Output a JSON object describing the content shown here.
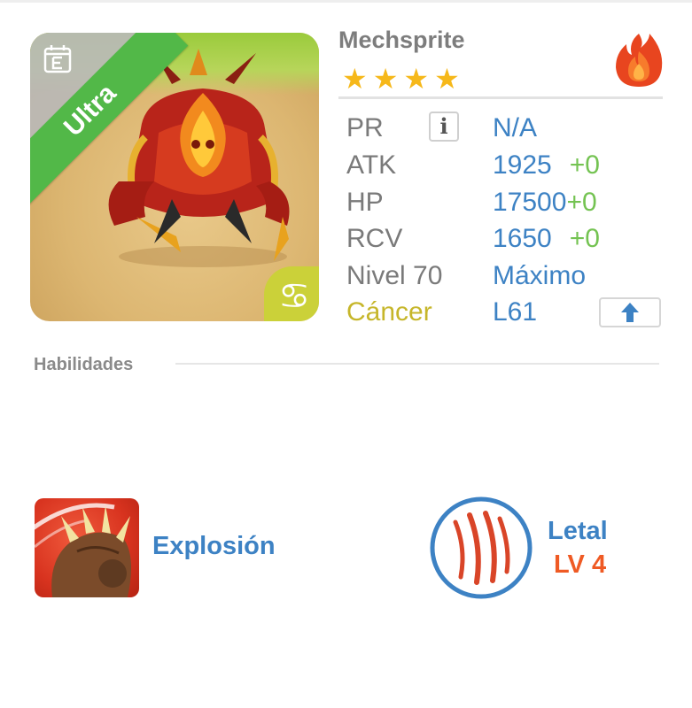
{
  "monster": {
    "name": "Mechsprite",
    "rank_label": "Ultra",
    "stars": [
      "★",
      "★",
      "★",
      "★"
    ],
    "element": "fire",
    "zodiac_glyph": "♋",
    "colors": {
      "ribbon": "#52b848",
      "star": "#f6b81a",
      "value": "#3d82c4",
      "bonus": "#74c352",
      "zodiac": "#c6b62a"
    }
  },
  "stats": {
    "pr": {
      "label": "PR",
      "value": "N/A",
      "info_glyph": "i"
    },
    "atk": {
      "label": "ATK",
      "value": "1925",
      "bonus": "+0"
    },
    "hp": {
      "label": "HP",
      "value": "17500",
      "bonus": "+0"
    },
    "rcv": {
      "label": "RCV",
      "value": "1650",
      "bonus": "+0"
    },
    "level": {
      "label": "Nivel 70",
      "value": "Máximo"
    },
    "zodiac": {
      "label": "Cáncer",
      "value": "L61"
    }
  },
  "skills": {
    "section_title": "Habilidades",
    "active": {
      "name": "Explosión",
      "icon": "claw-fist-icon"
    },
    "passive": {
      "name": "Letal",
      "level": "LV 4",
      "icon": "claw-marks-icon"
    }
  }
}
